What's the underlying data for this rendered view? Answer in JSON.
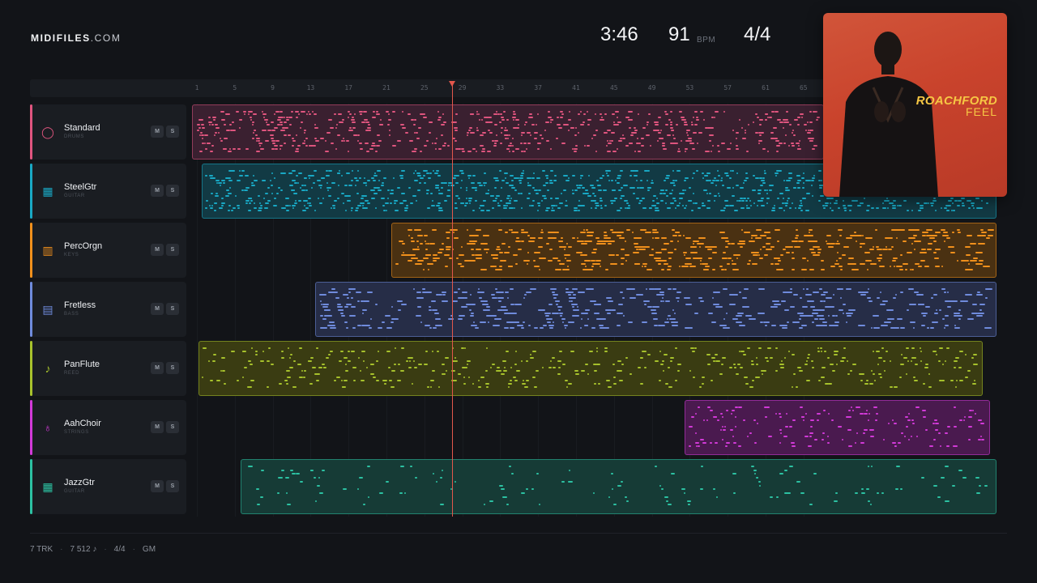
{
  "brand": {
    "name_bold": "MIDIFILES",
    "name_light": ".COM"
  },
  "transport": {
    "duration": "3:46",
    "tempo": "91",
    "tempo_unit": "BPM",
    "time_signature": "4/4"
  },
  "cover": {
    "artist": "ROACHFORD",
    "title": "FEEL",
    "bg_color": "#c9442d",
    "text_color": "#f6c744"
  },
  "ruler": {
    "bars": [
      "1",
      "5",
      "9",
      "13",
      "17",
      "21",
      "25",
      "29",
      "33",
      "37",
      "41",
      "45",
      "49",
      "53",
      "57",
      "61",
      "65"
    ]
  },
  "playhead": {
    "bar": 27,
    "color": "#e2574c"
  },
  "tracks": [
    {
      "name": "Standard",
      "category": "DRUMS",
      "icon": "drum-icon",
      "glyph": "◯",
      "color": "#e0557f",
      "region_bg": "#3a2030",
      "mute": "M",
      "solo": "S"
    },
    {
      "name": "SteelGtr",
      "category": "GUITAR",
      "icon": "guitar-grid-icon",
      "glyph": "▦",
      "color": "#19a8c4",
      "region_bg": "#123a44",
      "mute": "M",
      "solo": "S"
    },
    {
      "name": "PercOrgn",
      "category": "KEYS",
      "icon": "keyboard-icon",
      "glyph": "▥",
      "color": "#f0901c",
      "region_bg": "#4a3112",
      "mute": "M",
      "solo": "S"
    },
    {
      "name": "Fretless",
      "category": "BASS",
      "icon": "bass-icon",
      "glyph": "▤",
      "color": "#6f8bdc",
      "region_bg": "#262d47",
      "mute": "M",
      "solo": "S"
    },
    {
      "name": "PanFlute",
      "category": "REED",
      "icon": "flute-icon",
      "glyph": "♪",
      "color": "#a7c22c",
      "region_bg": "#3a3c12",
      "mute": "M",
      "solo": "S"
    },
    {
      "name": "AahChoir",
      "category": "STRINGS",
      "icon": "violin-icon",
      "glyph": "♁",
      "color": "#d23ad8",
      "region_bg": "#4a1a4f",
      "mute": "M",
      "solo": "S"
    },
    {
      "name": "JazzGtr",
      "category": "GUITAR",
      "icon": "guitar-grid-icon",
      "glyph": "▦",
      "color": "#2cc1a2",
      "region_bg": "#163b36",
      "mute": "M",
      "solo": "S"
    }
  ],
  "footer": {
    "tracks": "7 TRK",
    "notes": "7 512 ♪",
    "time_signature": "4/4",
    "standard": "GM"
  }
}
